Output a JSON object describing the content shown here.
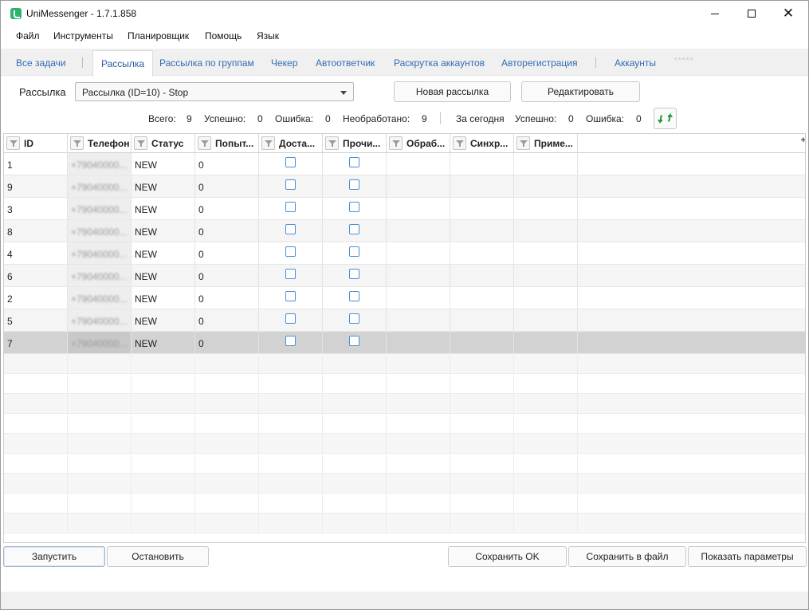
{
  "window": {
    "title": "UniMessenger - 1.7.1.858",
    "minimize_icon": "minimize-icon",
    "maximize_icon": "maximize-icon",
    "close_glyph": "✕"
  },
  "menu": [
    "Файл",
    "Инструменты",
    "Планировщик",
    "Помощь",
    "Язык"
  ],
  "tabs": [
    {
      "label": "Все задачи",
      "active": false
    },
    {
      "label": "Рассылка",
      "active": true
    },
    {
      "label": "Рассылка по группам",
      "active": false
    },
    {
      "label": "Чекер",
      "active": false
    },
    {
      "label": "Автоответчик",
      "active": false
    },
    {
      "label": "Раскрутка аккаунтов",
      "active": false
    },
    {
      "label": "Авторегистрация",
      "active": false
    },
    {
      "label": "Аккаунты",
      "active": false
    }
  ],
  "tab_dots": "*****",
  "campaign": {
    "label": "Рассылка",
    "selected": "Рассылка (ID=10) - Stop",
    "new_button": "Новая рассылка",
    "edit_button": "Редактировать"
  },
  "stats": {
    "total_label": "Всего:",
    "total": "9",
    "success_label": "Успешно:",
    "success": "0",
    "error_label": "Ошибка:",
    "error": "0",
    "unprocessed_label": "Необработано:",
    "unprocessed": "9",
    "today_label": "За сегодня",
    "today_success_label": "Успешно:",
    "today_success": "0",
    "today_error_label": "Ошибка:",
    "today_error": "0"
  },
  "grid": {
    "columns": [
      "ID",
      "Телефон",
      "Статус",
      "Попыт...",
      "Доста...",
      "Прочи...",
      "Обраб...",
      "Синхр...",
      "Приме..."
    ],
    "add_column": "+",
    "rows": [
      {
        "id": "1",
        "phone": "+79040000...",
        "status": "NEW",
        "attempts": "0"
      },
      {
        "id": "9",
        "phone": "+79040000...",
        "status": "NEW",
        "attempts": "0"
      },
      {
        "id": "3",
        "phone": "+79040000...",
        "status": "NEW",
        "attempts": "0"
      },
      {
        "id": "8",
        "phone": "+79040000...",
        "status": "NEW",
        "attempts": "0"
      },
      {
        "id": "4",
        "phone": "+79040000...",
        "status": "NEW",
        "attempts": "0"
      },
      {
        "id": "6",
        "phone": "+79040000...",
        "status": "NEW",
        "attempts": "0"
      },
      {
        "id": "2",
        "phone": "+79040000...",
        "status": "NEW",
        "attempts": "0"
      },
      {
        "id": "5",
        "phone": "+79040000...",
        "status": "NEW",
        "attempts": "0"
      },
      {
        "id": "7",
        "phone": "+79040000...",
        "status": "NEW",
        "attempts": "0",
        "selected": true
      }
    ]
  },
  "buttons": {
    "start": "Запустить",
    "stop": "Остановить",
    "save_ok": "Сохранить OK",
    "save_file": "Сохранить в файл",
    "show_params": "Показать параметры"
  },
  "colors": {
    "accent": "#2f6db5",
    "selected_row": "#d2d2d2",
    "refresh_green": "#2e9c3e"
  }
}
